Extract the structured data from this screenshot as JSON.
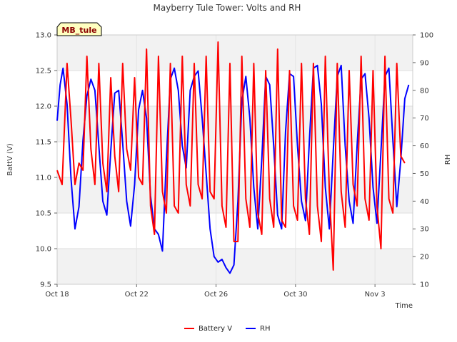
{
  "chart_data": {
    "type": "line",
    "title": "Mayberry Tule Tower: Volts and RH",
    "badge": "MB_tule",
    "xlabel": "Time",
    "ylabel_left": "BattV (V)",
    "ylabel_right": "RH",
    "xlim": [
      0,
      17.9
    ],
    "ylim_left": [
      9.5,
      13.0
    ],
    "ylim_right": [
      10,
      100
    ],
    "x_ticks": [
      {
        "x": 0,
        "label": "Oct 18"
      },
      {
        "x": 4,
        "label": "Oct 22"
      },
      {
        "x": 8,
        "label": "Oct 26"
      },
      {
        "x": 12,
        "label": "Oct 30"
      },
      {
        "x": 16,
        "label": "Nov 3"
      }
    ],
    "y_ticks_left": [
      "9.5",
      "10.0",
      "10.5",
      "11.0",
      "11.5",
      "12.0",
      "12.5",
      "13.0"
    ],
    "y_ticks_right": [
      "10",
      "20",
      "30",
      "40",
      "50",
      "60",
      "70",
      "80",
      "90",
      "100"
    ],
    "grid": true,
    "legend_position": "bottom-center",
    "series": [
      {
        "name": "Battery V",
        "axis": "left",
        "color": "#ff0000",
        "x": [
          0.0,
          0.25,
          0.5,
          0.7,
          0.9,
          1.1,
          1.3,
          1.5,
          1.7,
          1.9,
          2.1,
          2.3,
          2.5,
          2.7,
          2.9,
          3.1,
          3.3,
          3.5,
          3.7,
          3.9,
          4.1,
          4.3,
          4.5,
          4.7,
          4.9,
          5.1,
          5.3,
          5.5,
          5.7,
          5.9,
          6.1,
          6.3,
          6.5,
          6.7,
          6.9,
          7.1,
          7.3,
          7.5,
          7.7,
          7.9,
          8.1,
          8.3,
          8.5,
          8.7,
          8.9,
          9.1,
          9.3,
          9.5,
          9.7,
          9.9,
          10.1,
          10.3,
          10.5,
          10.7,
          10.9,
          11.1,
          11.3,
          11.5,
          11.7,
          11.9,
          12.1,
          12.3,
          12.5,
          12.7,
          12.9,
          13.1,
          13.3,
          13.5,
          13.7,
          13.9,
          14.1,
          14.3,
          14.5,
          14.7,
          14.9,
          15.1,
          15.3,
          15.5,
          15.7,
          15.9,
          16.1,
          16.3,
          16.5,
          16.7,
          16.9,
          17.1,
          17.3,
          17.5
        ],
        "values": [
          11.1,
          10.9,
          12.6,
          11.8,
          10.9,
          11.2,
          11.1,
          12.7,
          11.4,
          10.9,
          12.6,
          11.2,
          10.8,
          12.4,
          11.3,
          10.8,
          12.6,
          11.4,
          11.1,
          12.4,
          11.0,
          10.9,
          12.8,
          10.6,
          10.2,
          12.7,
          10.8,
          10.5,
          12.6,
          10.6,
          10.5,
          12.7,
          10.9,
          10.6,
          12.6,
          10.9,
          10.7,
          12.7,
          10.8,
          10.7,
          12.9,
          10.6,
          10.3,
          12.6,
          10.1,
          10.1,
          12.7,
          10.7,
          10.3,
          12.6,
          10.5,
          10.2,
          12.5,
          10.7,
          10.3,
          12.8,
          10.4,
          10.3,
          12.5,
          10.6,
          10.4,
          12.6,
          10.7,
          10.2,
          12.6,
          10.6,
          10.1,
          12.7,
          10.8,
          9.7,
          12.6,
          10.8,
          10.3,
          12.5,
          10.9,
          10.6,
          12.7,
          10.7,
          10.4,
          12.5,
          10.6,
          10.0,
          12.7,
          10.7,
          10.5,
          12.6,
          11.3,
          11.2
        ]
      },
      {
        "name": "RH",
        "axis": "right",
        "color": "#0000ff",
        "x": [
          0.0,
          0.15,
          0.3,
          0.5,
          0.7,
          0.9,
          1.1,
          1.3,
          1.5,
          1.7,
          1.9,
          2.1,
          2.3,
          2.5,
          2.7,
          2.9,
          3.1,
          3.3,
          3.5,
          3.7,
          3.9,
          4.1,
          4.3,
          4.5,
          4.7,
          4.9,
          5.1,
          5.3,
          5.5,
          5.7,
          5.9,
          6.1,
          6.3,
          6.5,
          6.7,
          6.9,
          7.1,
          7.3,
          7.5,
          7.7,
          7.9,
          8.1,
          8.3,
          8.5,
          8.7,
          8.9,
          9.1,
          9.3,
          9.5,
          9.7,
          9.9,
          10.1,
          10.3,
          10.5,
          10.7,
          10.9,
          11.1,
          11.3,
          11.5,
          11.7,
          11.9,
          12.1,
          12.3,
          12.5,
          12.7,
          12.9,
          13.1,
          13.3,
          13.5,
          13.7,
          13.9,
          14.1,
          14.3,
          14.5,
          14.7,
          14.9,
          15.1,
          15.3,
          15.5,
          15.7,
          15.9,
          16.1,
          16.3,
          16.5,
          16.7,
          16.9,
          17.1,
          17.3,
          17.5,
          17.7
        ],
        "values": [
          69,
          82,
          88,
          75,
          48,
          30,
          38,
          62,
          78,
          84,
          80,
          60,
          40,
          35,
          58,
          79,
          80,
          61,
          40,
          31,
          46,
          73,
          80,
          70,
          42,
          30,
          28,
          22,
          55,
          84,
          88,
          80,
          60,
          52,
          80,
          85,
          87,
          70,
          50,
          30,
          20,
          18,
          19,
          16,
          14,
          17,
          40,
          76,
          85,
          70,
          45,
          30,
          55,
          85,
          82,
          60,
          35,
          30,
          65,
          86,
          85,
          60,
          40,
          33,
          62,
          88,
          89,
          75,
          45,
          30,
          58,
          85,
          89,
          60,
          40,
          32,
          60,
          84,
          86,
          70,
          45,
          32,
          58,
          85,
          88,
          62,
          38,
          55,
          77,
          82
        ]
      }
    ]
  }
}
